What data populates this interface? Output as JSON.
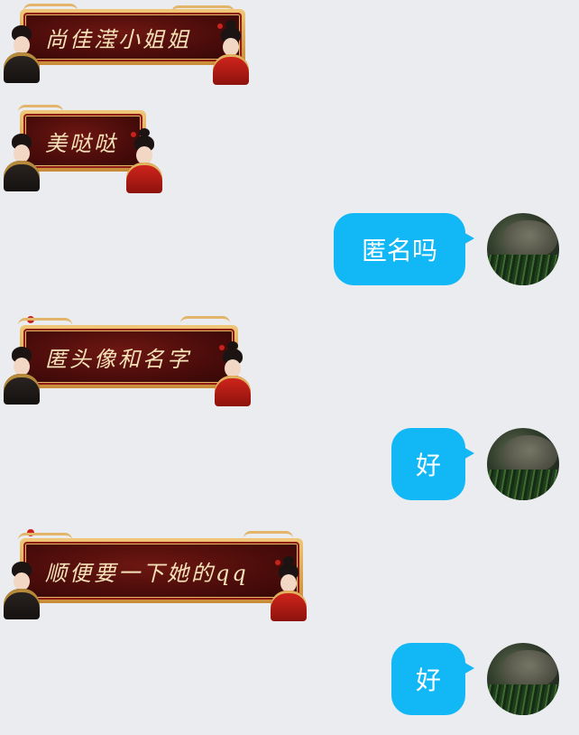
{
  "messages": [
    {
      "side": "received",
      "text": "尚佳滢小姐姐"
    },
    {
      "side": "received",
      "text": "美哒哒"
    },
    {
      "side": "sent",
      "text": "匿名吗"
    },
    {
      "side": "received",
      "text": "匿头像和名字"
    },
    {
      "side": "sent",
      "text": "好"
    },
    {
      "side": "received",
      "text": "顺便要一下她的qq"
    },
    {
      "side": "sent",
      "text": "好"
    }
  ],
  "colors": {
    "background": "#eaecef",
    "sent_bubble": "#12b7f5",
    "received_frame": "#c98d3a",
    "received_fill": "#4a0c0a"
  }
}
